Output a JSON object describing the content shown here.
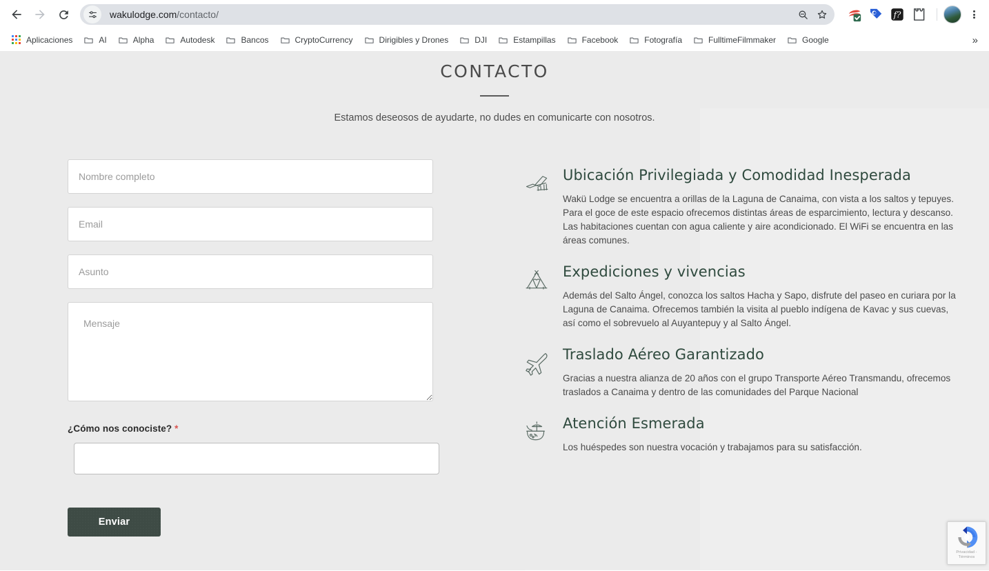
{
  "browser": {
    "nav": {
      "back_label": "Back",
      "forward_label": "Forward",
      "reload_label": "Reload"
    },
    "omnibox": {
      "site_settings_icon": "tune-icon",
      "url_host": "wakulodge.com",
      "url_path": "/contacto/",
      "zoom_icon": "search-zoom-icon",
      "bookmark_icon": "star-icon"
    },
    "extensions": [
      {
        "name": "adblock-extension-icon",
        "label": ""
      },
      {
        "name": "tag-extension-icon",
        "label": ""
      },
      {
        "name": "formula-extension-icon",
        "label": "f?"
      },
      {
        "name": "puzzle-extensions-icon",
        "label": ""
      }
    ],
    "profile_label": "Profile",
    "menu_label": "Customize and control Chrome",
    "bookmarks": [
      {
        "label": "Aplicaciones",
        "icon": "apps-grid-icon"
      },
      {
        "label": "AI",
        "icon": "folder-icon"
      },
      {
        "label": "Alpha",
        "icon": "folder-icon"
      },
      {
        "label": "Autodesk",
        "icon": "folder-icon"
      },
      {
        "label": "Bancos",
        "icon": "folder-icon"
      },
      {
        "label": "CryptoCurrency",
        "icon": "folder-icon"
      },
      {
        "label": "Dirigibles y Drones",
        "icon": "folder-icon"
      },
      {
        "label": "DJI",
        "icon": "folder-icon"
      },
      {
        "label": "Estampillas",
        "icon": "folder-icon"
      },
      {
        "label": "Facebook",
        "icon": "folder-icon"
      },
      {
        "label": "Fotografía",
        "icon": "folder-icon"
      },
      {
        "label": "FulltimeFilmmaker",
        "icon": "folder-icon"
      },
      {
        "label": "Google",
        "icon": "folder-icon"
      }
    ],
    "bookmarks_overflow": "»"
  },
  "page": {
    "title": "CONTACTO",
    "subtitle": "Estamos deseosos de ayudarte, no dudes en comunicarte con nosotros.",
    "form": {
      "name_placeholder": "Nombre completo",
      "name_value": "",
      "email_placeholder": "Email",
      "email_value": "",
      "subject_placeholder": "Asunto",
      "subject_value": "",
      "message_placeholder": "Mensaje",
      "message_value": "",
      "referral_label": "¿Cómo nos conociste?",
      "referral_required_mark": "*",
      "referral_value": "",
      "referral_placeholder": "",
      "submit_label": "Enviar"
    },
    "info_blocks": [
      {
        "icon": "lounge-chair-icon",
        "heading": "Ubicación Privilegiada y Comodidad Inesperada",
        "text": "Wakü Lodge se encuentra a orillas de la Laguna de Canaima, con vista a los saltos y tepuyes. Para el goce de este espacio ofrecemos distintas áreas de esparcimiento, lectura y descanso. Las habitaciones cuentan con agua caliente y aire acondicionado. El WiFi se encuentra en las áreas comunes."
      },
      {
        "icon": "teepee-tent-icon",
        "heading": "Expediciones y vivencias",
        "text": "Además del Salto Ángel, conozca los saltos Hacha y Sapo, disfrute del paseo en curiara por la Laguna de Canaima. Ofrecemos también la visita al pueblo indígena de Kavac y sus cuevas, así como el sobrevuelo al Auyantepuy y al Salto Ángel."
      },
      {
        "icon": "airplane-icon",
        "heading": "Traslado Aéreo Garantizado",
        "text": "Gracias a nuestra alianza de 20 años con el grupo Transporte Aéreo Transmandu, ofrecemos traslados a Canaima y dentro de las comunidades del Parque Nacional"
      },
      {
        "icon": "coconut-drink-icon",
        "heading": "Atención Esmerada",
        "text": "Los huéspedes son nuestra vocación y trabajamos para su satisfacción."
      }
    ],
    "recaptcha": {
      "privacy_terms": "Privacidad - Términos",
      "logo_icon": "recaptcha-logo-icon"
    }
  },
  "colors": {
    "page_bg": "#ebebeb",
    "panel_bg": "#eeeeee",
    "heading_green": "#2f4a3e",
    "button_bg": "#3e4b45",
    "required_red": "#d9534f"
  }
}
